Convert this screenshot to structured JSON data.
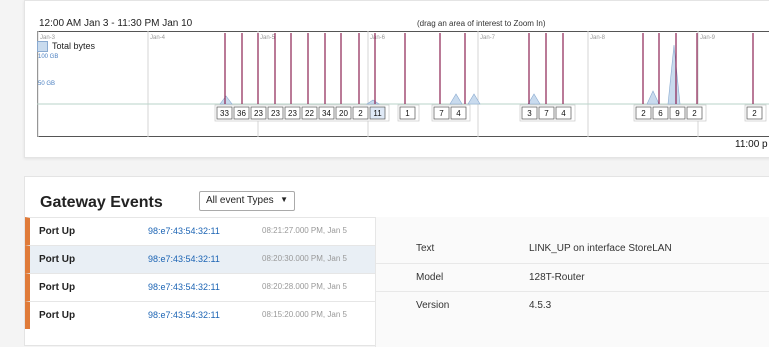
{
  "timeline": {
    "range_label": "12:00 AM Jan 3 - 11:30 PM Jan 10",
    "zoom_hint": "(drag an area of interest to Zoom In)",
    "legend_label": "Total bytes",
    "axis_labels": [
      "100 GB",
      "50 GB"
    ],
    "end_time": "11:00 p",
    "day_labels": [
      "Jan-3",
      "Jan-4",
      "Jan-5",
      "Jan-6",
      "Jan-7",
      "Jan-8",
      "Jan-9"
    ],
    "counts": [
      "33",
      "36",
      "23",
      "23",
      "23",
      "22",
      "34",
      "20",
      "2",
      "11",
      "1",
      "7",
      "4",
      "3",
      "7",
      "4",
      "2",
      "6",
      "9",
      "2",
      "2"
    ],
    "colors": {
      "event_line": "#8b2252",
      "area_fill": "#c9dbee",
      "area_stroke": "#8aaad0",
      "baseline": "#b9d3c9"
    }
  },
  "events": {
    "title": "Gateway Events",
    "filter": {
      "selected": "All event Types"
    },
    "rows": [
      {
        "event": "Port Up",
        "mac": "98:e7:43:54:32:11",
        "time": "08:21:27.000 PM, Jan 5"
      },
      {
        "event": "Port Up",
        "mac": "98:e7:43:54:32:11",
        "time": "08:20:30.000 PM, Jan 5"
      },
      {
        "event": "Port Up",
        "mac": "98:e7:43:54:32:11",
        "time": "08:20:28.000 PM, Jan 5"
      },
      {
        "event": "Port Up",
        "mac": "98:e7:43:54:32:11",
        "time": "08:15:20.000 PM, Jan 5"
      }
    ],
    "details": [
      {
        "key": "Text",
        "value": "LINK_UP on interface StoreLAN"
      },
      {
        "key": "Model",
        "value": "128T-Router"
      },
      {
        "key": "Version",
        "value": "4.5.3"
      }
    ],
    "colors": {
      "accent": "#e07b39",
      "link": "#1c64b4",
      "selected_row": "#e9eff5"
    }
  }
}
